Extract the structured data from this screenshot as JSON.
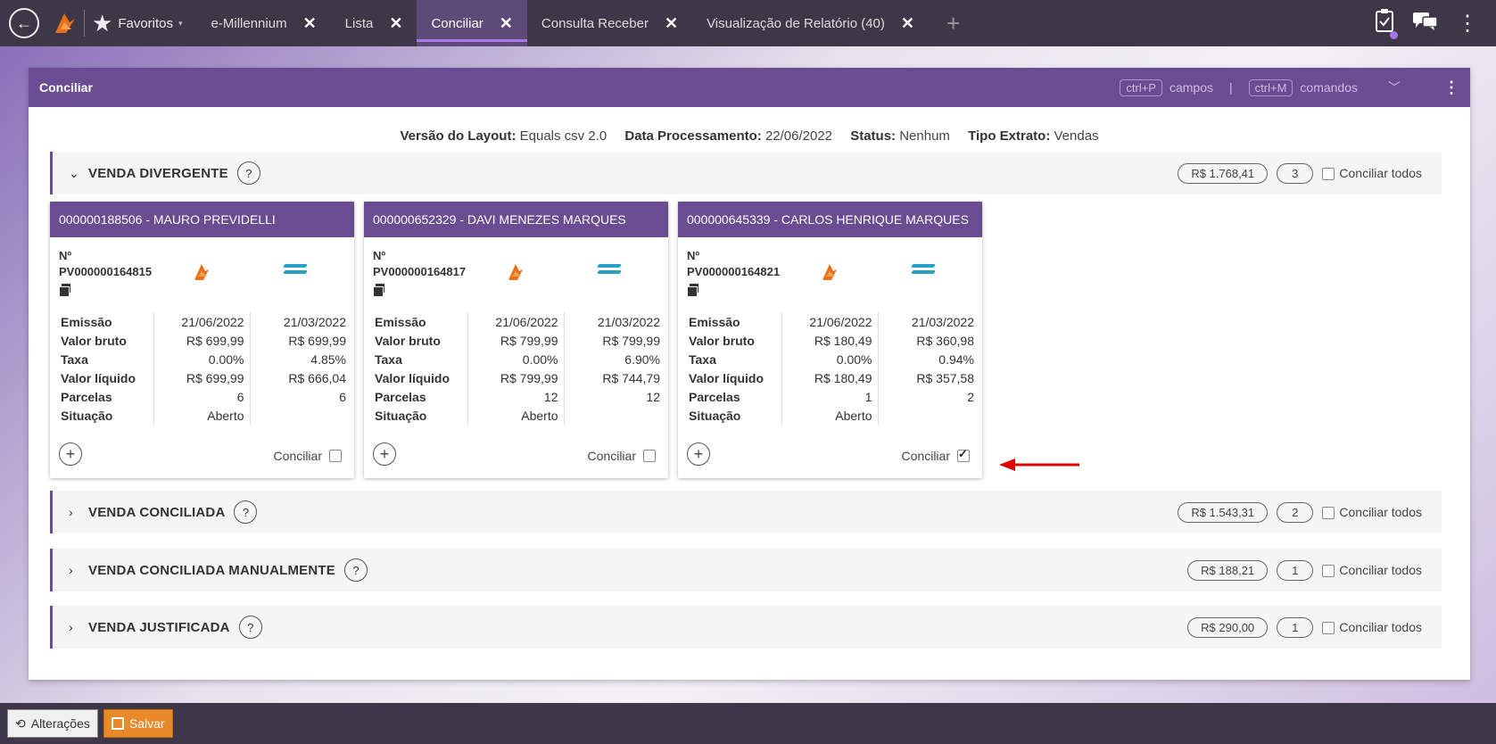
{
  "topbar": {
    "favorites_label": "Favoritos",
    "tabs": [
      {
        "label": "e-Millennium",
        "close": "✕"
      },
      {
        "label": "Lista",
        "close": "✕"
      },
      {
        "label": "Conciliar",
        "close": "✕"
      },
      {
        "label": "Consulta Receber",
        "close": "✕"
      },
      {
        "label": "Visualização de Relatório (40)",
        "close": "✕"
      }
    ],
    "add_tab": "+",
    "active_tab": "Conciliar",
    "icons": [
      "back-icon",
      "app-logo",
      "star-icon",
      "clipboard-check-icon",
      "chat-icon",
      "more-vertical-icon"
    ]
  },
  "panel": {
    "title": "Conciliar",
    "shortcut1_key": "ctrl+P",
    "shortcut1_label": "campos",
    "pipe": "|",
    "shortcut2_key": "ctrl+M",
    "shortcut2_label": "comandos"
  },
  "info": {
    "layout_label": "Versão do Layout:",
    "layout_value": "Equals csv 2.0",
    "date_label": "Data Processamento:",
    "date_value": "22/06/2022",
    "status_label": "Status:",
    "status_value": "Nenhum",
    "tipo_label": "Tipo Extrato:",
    "tipo_value": "Vendas"
  },
  "sections": [
    {
      "title": "VENDA DIVERGENTE",
      "amount": "R$ 1.768,41",
      "count": "3",
      "check_label": "Conciliar todos",
      "expanded": true
    },
    {
      "title": "VENDA CONCILIADA",
      "amount": "R$ 1.543,31",
      "count": "2",
      "check_label": "Conciliar todos",
      "expanded": false
    },
    {
      "title": "VENDA CONCILIADA MANUALMENTE",
      "amount": "R$ 188,21",
      "count": "1",
      "check_label": "Conciliar todos",
      "expanded": false
    },
    {
      "title": "VENDA JUSTIFICADA",
      "amount": "R$ 290,00",
      "count": "1",
      "check_label": "Conciliar todos",
      "expanded": false
    }
  ],
  "cards": [
    {
      "header": "000000188506 - MAURO PREVIDELLI",
      "nr_label": "Nº",
      "nr_value": "PV000000164815",
      "rows": [
        {
          "label": "Emissão",
          "v1": "21/06/2022",
          "v2": "21/03/2022"
        },
        {
          "label": "Valor bruto",
          "v1": "R$ 699,99",
          "v2": "R$ 699,99"
        },
        {
          "label": "Taxa",
          "v1": "0.00%",
          "v2": "4.85%"
        },
        {
          "label": "Valor líquido",
          "v1": "R$ 699,99",
          "v2": "R$ 666,04"
        },
        {
          "label": "Parcelas",
          "v1": "6",
          "v2": "6"
        },
        {
          "label": "Situação",
          "v1": "Aberto",
          "v2": ""
        }
      ],
      "conciliar_label": "Conciliar",
      "checked": false
    },
    {
      "header": "000000652329 - DAVI MENEZES MARQUES",
      "nr_label": "Nº",
      "nr_value": "PV000000164817",
      "rows": [
        {
          "label": "Emissão",
          "v1": "21/06/2022",
          "v2": "21/03/2022"
        },
        {
          "label": "Valor bruto",
          "v1": "R$ 799,99",
          "v2": "R$ 799,99"
        },
        {
          "label": "Taxa",
          "v1": "0.00%",
          "v2": "6.90%"
        },
        {
          "label": "Valor líquido",
          "v1": "R$ 799,99",
          "v2": "R$ 744,79"
        },
        {
          "label": "Parcelas",
          "v1": "12",
          "v2": "12"
        },
        {
          "label": "Situação",
          "v1": "Aberto",
          "v2": ""
        }
      ],
      "conciliar_label": "Conciliar",
      "checked": false
    },
    {
      "header": "000000645339 - CARLOS HENRIQUE MARQUES",
      "nr_label": "Nº",
      "nr_value": "PV000000164821",
      "rows": [
        {
          "label": "Emissão",
          "v1": "21/06/2022",
          "v2": "21/03/2022"
        },
        {
          "label": "Valor bruto",
          "v1": "R$ 180,49",
          "v2": "R$ 360,98"
        },
        {
          "label": "Taxa",
          "v1": "0.00%",
          "v2": "0.94%"
        },
        {
          "label": "Valor líquido",
          "v1": "R$ 180,49",
          "v2": "R$ 357,58"
        },
        {
          "label": "Parcelas",
          "v1": "1",
          "v2": "2"
        },
        {
          "label": "Situação",
          "v1": "Aberto",
          "v2": ""
        }
      ],
      "conciliar_label": "Conciliar",
      "checked": true
    }
  ],
  "bottom": {
    "alteracoes_label": "Alterações",
    "salvar_label": "Salvar"
  },
  "colors": {
    "brand_purple": "#6a4c93",
    "tab_active_underline": "#a878e8",
    "save_orange": "#e8892a",
    "annotation_arrow": "#e00000",
    "bank_blue": "#2aa0c8",
    "logo_orange": "#e8701a"
  }
}
